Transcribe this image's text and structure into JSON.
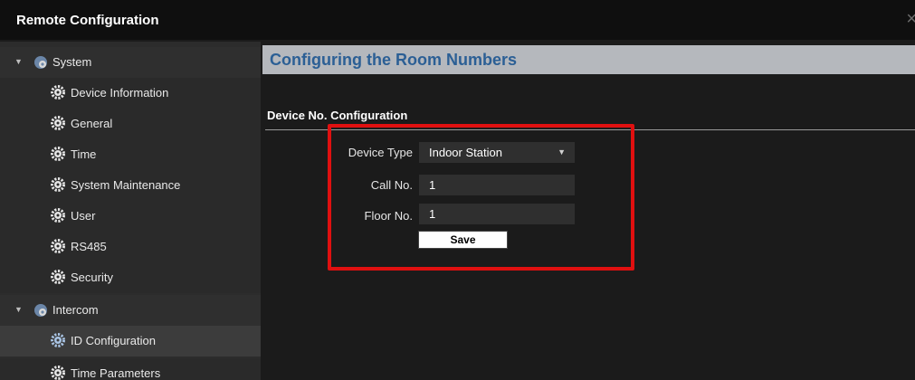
{
  "window": {
    "title": "Remote Configuration",
    "close_glyph": "×"
  },
  "sidebar": {
    "groups": [
      {
        "label": "System",
        "expanded": true,
        "items": [
          {
            "label": "Device Information"
          },
          {
            "label": "General"
          },
          {
            "label": "Time"
          },
          {
            "label": "System Maintenance"
          },
          {
            "label": "User"
          },
          {
            "label": "RS485"
          },
          {
            "label": "Security"
          }
        ]
      },
      {
        "label": "Intercom",
        "expanded": true,
        "items": [
          {
            "label": "ID Configuration",
            "selected": true
          },
          {
            "label": "Time Parameters"
          }
        ]
      }
    ]
  },
  "main": {
    "section_title": "Configuring the Room Numbers",
    "subsection_title": "Device No. Configuration",
    "form": {
      "device_type": {
        "label": "Device Type",
        "value": "Indoor Station"
      },
      "call_no": {
        "label": "Call No.",
        "value": "1"
      },
      "floor_no": {
        "label": "Floor No.",
        "value": "1"
      },
      "save_label": "Save"
    }
  },
  "colors": {
    "highlight_border": "#e01010",
    "section_header_bg": "#b5b8bd",
    "section_header_text": "#2b5f95"
  }
}
